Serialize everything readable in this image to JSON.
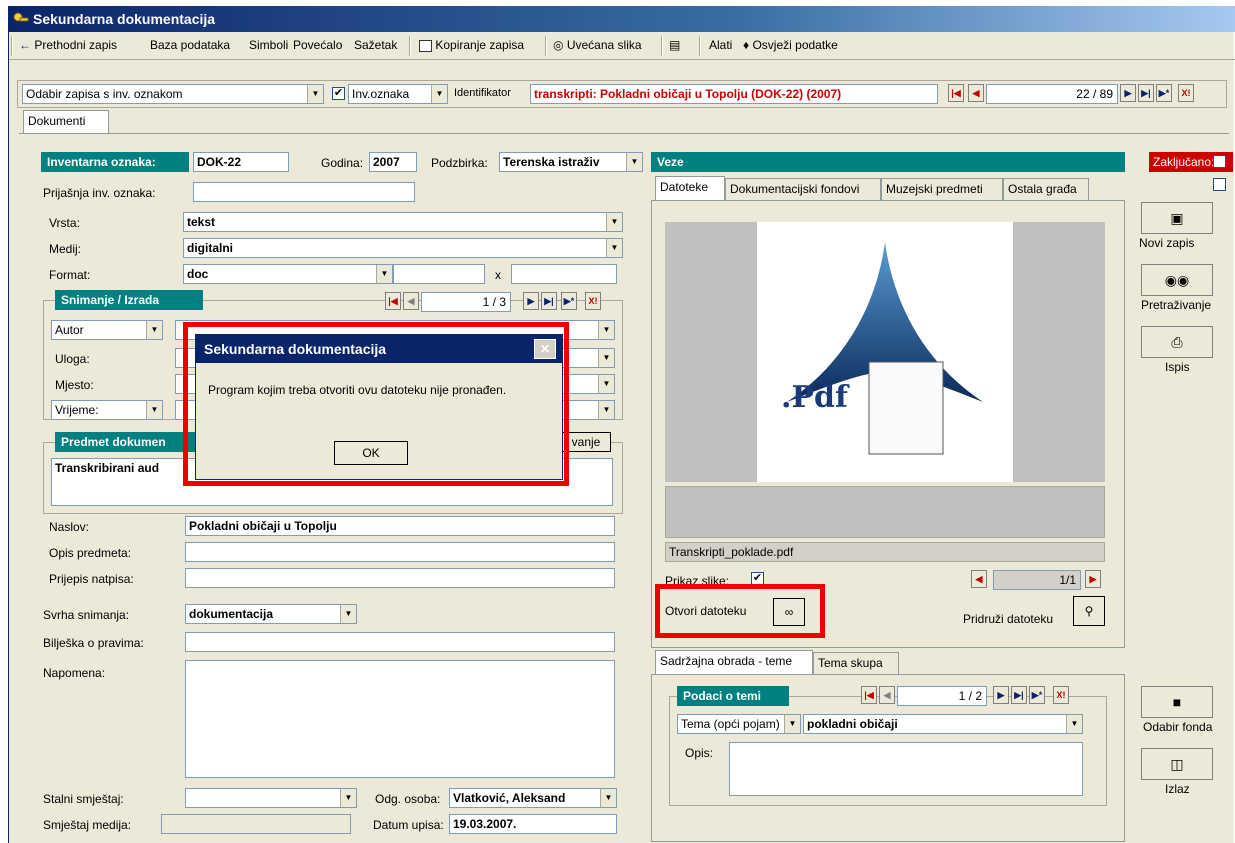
{
  "window": {
    "title": "Sekundarna dokumentacija"
  },
  "menu": {
    "prev": "Prethodni zapis",
    "db": "Baza podataka",
    "symbols": "Simboli",
    "magnifier": "Povećalo",
    "summary": "Sažetak",
    "copy": "Kopiranje zapisa",
    "enlarged": "Uvećana slika",
    "tools": "Alati",
    "refresh": "Osvježi podatke"
  },
  "recordbar": {
    "select_label": "Odabir zapisa s inv. oznakom",
    "select_value": "",
    "inv_label": "Inv.oznaka",
    "identifier_label": "Identifikator",
    "identifier_value": "transkripti: Pokladni običaji u Topolju (DOK-22) (2007)",
    "counter": "22 / 89"
  },
  "main_tab": "Dokumenti",
  "form": {
    "inv_label": "Inventarna oznaka:",
    "inv_value": "DOK-22",
    "year_label": "Godina:",
    "year_value": "2007",
    "subcollection_label": "Podzbirka:",
    "subcollection_value": "Terenska istraživ",
    "prev_inv_label": "Prijašnja inv. oznaka:",
    "prev_inv_value": "",
    "type_label": "Vrsta:",
    "type_value": "tekst",
    "medium_label": "Medij:",
    "medium_value": "digitalni",
    "format_label": "Format:",
    "format_value": "doc",
    "x_label": "x",
    "recording_header": "Snimanje / Izrada",
    "recording_counter": "1 / 3",
    "author_label": "Autor",
    "role_label": "Uloga:",
    "place_label": "Mjesto:",
    "time_label": "Vrijeme:",
    "subject_header": "Predmet dokumen",
    "subject_btn": "vanje",
    "subject_text": "Transkribirani aud",
    "title_label": "Naslov:",
    "title_value": "Pokladni običaji u Topolju",
    "desc_label": "Opis predmeta:",
    "inscription_label": "Prijepis natpisa:",
    "purpose_label": "Svrha snimanja:",
    "purpose_value": "dokumentacija",
    "rights_label": "Bilješka o pravima:",
    "note_label": "Napomena:",
    "location_label": "Stalni smještaj:",
    "resp_label": "Odg. osoba:",
    "resp_value": "Vlatković, Aleksand",
    "media_loc_label": "Smještaj medija:",
    "entry_date_label": "Datum upisa:",
    "entry_date_value": "19.03.2007."
  },
  "links": {
    "header": "Veze",
    "tabs": [
      "Datoteke",
      "Dokumentacijski fondovi",
      "Muzejski predmeti",
      "Ostala građa"
    ],
    "filename": "Transkripti_poklade.pdf",
    "show_image_label": "Prikaz slike:",
    "image_counter": "1/1",
    "open_file_label": "Otvori datoteku",
    "attach_file_label": "Pridruži datoteku",
    "pdf_text": ".Pdf"
  },
  "locked_label": "Zaključano:",
  "side_buttons": {
    "new": "Novi zapis",
    "search": "Pretraživanje",
    "print": "Ispis",
    "fund": "Odabir fonda",
    "exit": "Izlaz"
  },
  "theme": {
    "tabs": [
      "Sadržajna obrada - teme",
      "Tema skupa"
    ],
    "header": "Podaci o temi",
    "counter": "1 / 2",
    "topic_type": "Tema (opći pojam)",
    "topic_value": "pokladni običaji",
    "desc_label": "Opis:"
  },
  "dialog": {
    "title": "Sekundarna dokumentacija",
    "message": "Program kojim treba otvoriti ovu datoteku nije pronađen.",
    "ok": "OK"
  }
}
